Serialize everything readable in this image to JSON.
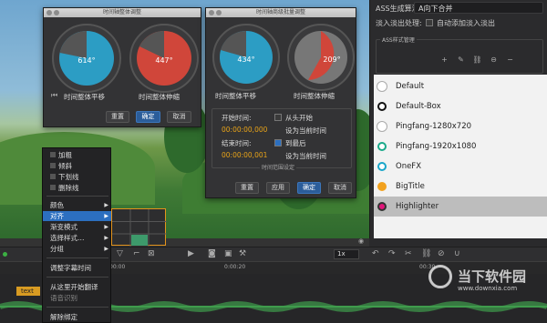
{
  "right_panel": {
    "algo_label": "ASS生成算法:",
    "algo_value": "A向下合并",
    "fade_label": "淡入淡出处理:",
    "fade_check_label": "自动添加淡入淡出",
    "style_mgr_title": "ASS样式管理",
    "styles": [
      {
        "name": "Default",
        "color": "#ffffff",
        "ring": "#ffffff"
      },
      {
        "name": "Default-Box",
        "color": "#ffffff",
        "ring": "#111111"
      },
      {
        "name": "Pingfang-1280x720",
        "color": "#ffffff",
        "ring": "#ffffff"
      },
      {
        "name": "Pingfang-1920x1080",
        "color": "#ffffff",
        "ring": "#1aa98a"
      },
      {
        "name": "OneFX",
        "color": "#ffffff",
        "ring": "#1aa6c9"
      },
      {
        "name": "BigTitle",
        "color": "#f2a11e",
        "ring": "#f2a11e"
      },
      {
        "name": "Highlighter",
        "color": "#e0177a",
        "ring": "#333333"
      }
    ]
  },
  "dialog1": {
    "title": "时间轴整体调整",
    "dial1_value": "614°",
    "dial2_value": "447°",
    "label_shift": "时间整体平移",
    "label_stretch": "时间整体伸缩",
    "btn_reset": "重置",
    "btn_ok": "确定",
    "btn_cancel": "取消"
  },
  "dialog2": {
    "title": "时间轴商级批量调整",
    "dial1_value": "434°",
    "dial2_value": "209°",
    "label_shift": "时间整体平移",
    "label_stretch": "时间整体伸缩",
    "start_label": "开始时间:",
    "start_check": "从头开始",
    "start_time": "00:00:00,000",
    "start_set": "设为当前时间",
    "end_label": "结束时间:",
    "end_check": "到最后",
    "end_time": "00:00:00,001",
    "end_set": "设为当前时间",
    "range_title": "时间范围设定",
    "btn_reset": "重置",
    "btn_apply": "应用",
    "btn_ok": "确定",
    "btn_cancel": "取消"
  },
  "context_menu": {
    "items": [
      "加粗",
      "倾斜",
      "下划线",
      "删除线",
      "颜色",
      "对齐",
      "渐变模式",
      "选择样式…",
      "分组",
      "调整字幕时间",
      "从这里开始翻译",
      "语音识别",
      "解除绑定"
    ]
  },
  "timeline": {
    "zoom": "1x",
    "ruler_0": "00:00",
    "ruler_1": "0:00:20",
    "ruler_2": "00:30",
    "clip_text": "text"
  },
  "watermark": {
    "name": "当下软件园",
    "url": "www.downxia.com"
  },
  "colors": {
    "accent": "#2c6fc0",
    "orange": "#e8a318",
    "dial_blue": "#2c9dc4",
    "dial_red": "#d0463a"
  }
}
